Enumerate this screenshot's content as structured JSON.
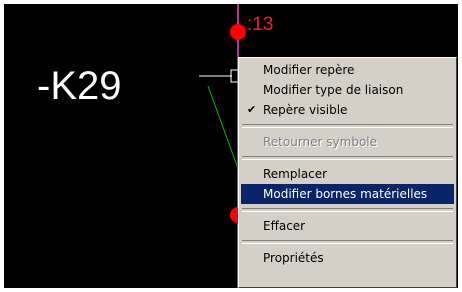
{
  "canvas": {
    "component_ref": "-K29",
    "terminal_number": ":13"
  },
  "context_menu": {
    "items": [
      {
        "label": "Modifier repère"
      },
      {
        "label": "Modifier type de liaison"
      },
      {
        "label": "Repère visible",
        "checked": true
      },
      {
        "label": "Retourner symbole",
        "disabled": true
      },
      {
        "label": "Remplacer"
      },
      {
        "label": "Modifier bornes matérielles",
        "selected": true
      },
      {
        "label": "Effacer"
      },
      {
        "label": "Propriétés"
      }
    ]
  },
  "colors": {
    "canvas_bg": "#000000",
    "wire_vertical": "#b0388c",
    "wire_diagonal": "#00c000",
    "terminal_dot": "#ff0000",
    "menu_bg": "#d4d0c8",
    "selection": "#0a246a"
  },
  "icons": {
    "check": "check-icon"
  }
}
